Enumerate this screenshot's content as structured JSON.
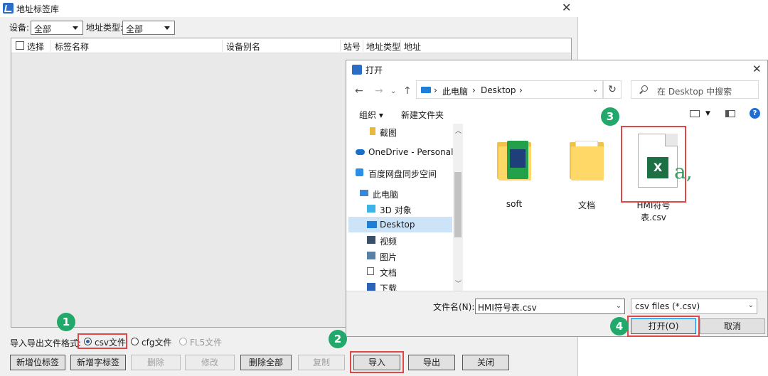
{
  "main": {
    "title": "地址标签库",
    "device_label": "设备:",
    "device_value": "全部",
    "addr_type_label": "地址类型:",
    "addr_type_value": "全部",
    "columns": [
      "选择",
      "标签名称",
      "设备别名",
      "站号",
      "地址类型",
      "地址"
    ],
    "format_label": "导入导出文件格式:",
    "formats": [
      {
        "label": "csv文件",
        "selected": true,
        "enabled": true
      },
      {
        "label": "cfg文件",
        "selected": false,
        "enabled": true
      },
      {
        "label": "FL5文件",
        "selected": false,
        "enabled": false
      }
    ],
    "buttons": [
      {
        "label": "新增位标签",
        "enabled": true
      },
      {
        "label": "新增字标签",
        "enabled": true
      },
      {
        "label": "删除",
        "enabled": false
      },
      {
        "label": "修改",
        "enabled": false
      },
      {
        "label": "删除全部",
        "enabled": true
      },
      {
        "label": "复制",
        "enabled": false
      },
      {
        "label": "导入",
        "enabled": true
      },
      {
        "label": "导出",
        "enabled": true
      },
      {
        "label": "关闭",
        "enabled": true
      }
    ]
  },
  "dialog": {
    "title": "打开",
    "breadcrumb": [
      "此电脑",
      "Desktop"
    ],
    "search_placeholder": "在 Desktop 中搜索",
    "organize": "组织 ▾",
    "new_folder": "新建文件夹",
    "nav_items": [
      {
        "label": "截图",
        "icon": "folder-icon"
      },
      {
        "label": "OneDrive - Personal",
        "icon": "cloud-icon"
      },
      {
        "label": "百度网盘同步空间",
        "icon": "cloud-sync-icon"
      },
      {
        "label": "此电脑",
        "icon": "computer-icon"
      },
      {
        "label": "3D 对象",
        "icon": "cube-icon"
      },
      {
        "label": "Desktop",
        "icon": "desktop-icon",
        "selected": true
      },
      {
        "label": "视频",
        "icon": "video-icon"
      },
      {
        "label": "图片",
        "icon": "picture-icon"
      },
      {
        "label": "文档",
        "icon": "document-icon"
      },
      {
        "label": "下载",
        "icon": "download-icon"
      }
    ],
    "files": [
      {
        "name": "soft",
        "icon": "folder-icon"
      },
      {
        "name": "文档",
        "icon": "folder-icon"
      },
      {
        "name": "HMI符号表.csv",
        "icon": "excel-csv-icon"
      }
    ],
    "filename_label": "文件名(N):",
    "filename_value": "HMI符号表.csv",
    "filetype_value": "csv files (*.csv)",
    "open_button": "打开(O)",
    "cancel_button": "取消"
  },
  "steps": [
    "1",
    "2",
    "3",
    "4"
  ],
  "colors": {
    "highlight": "#e04848",
    "step_badge": "#23a86b",
    "selection": "#cde3f7"
  }
}
